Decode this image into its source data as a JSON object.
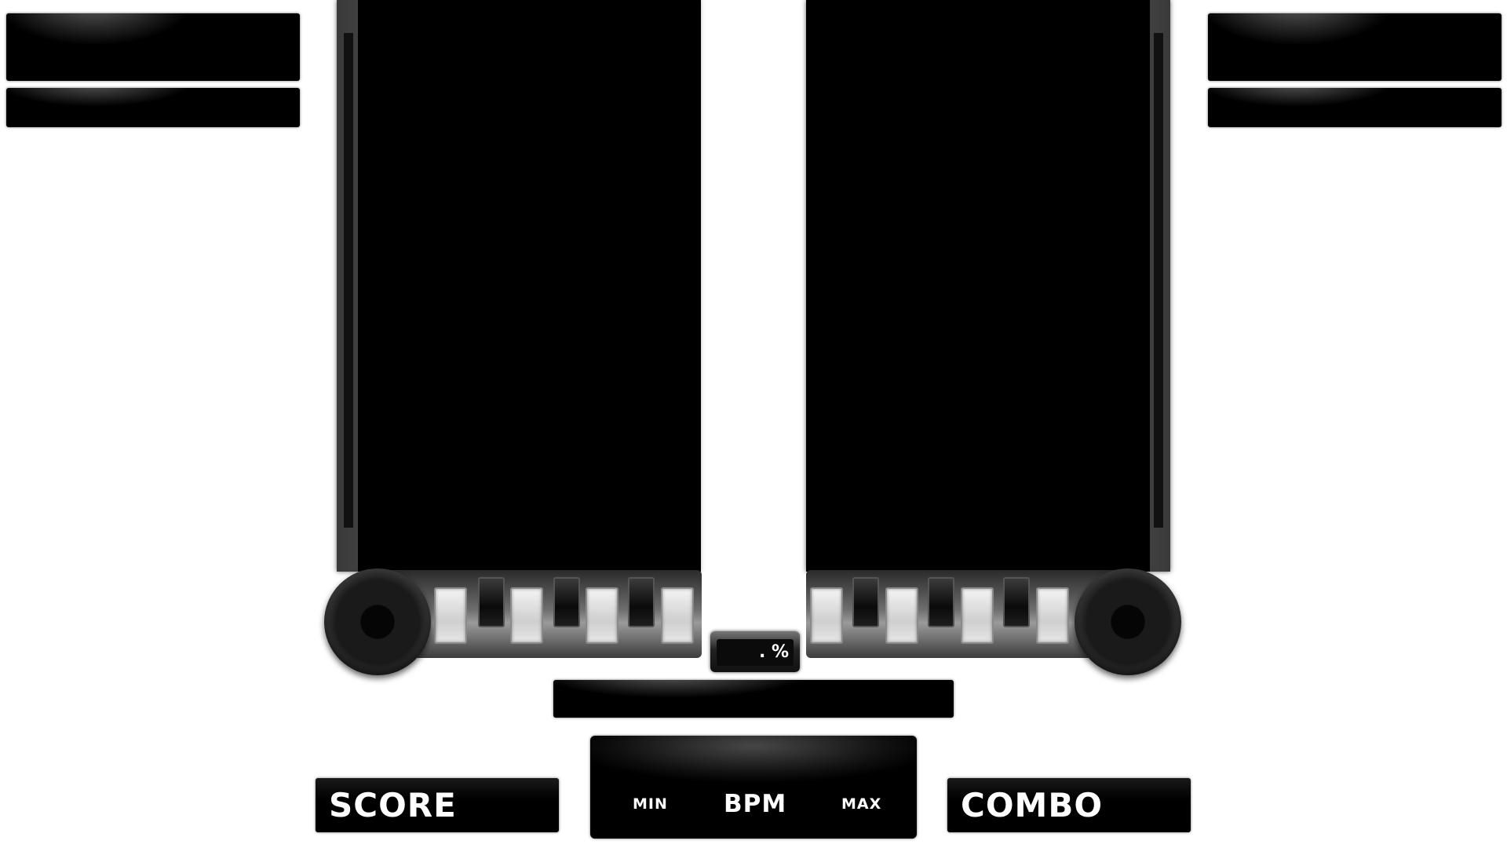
{
  "hud": {
    "score_label": "SCORE",
    "combo_label": "COMBO",
    "bpm_label": "BPM",
    "bpm_min_label": "MIN",
    "bpm_max_label": "MAX",
    "gauge_readout": ". %"
  },
  "colors": {
    "background": "#ffffff",
    "panel": "#000000",
    "frame": "#5a5a5a",
    "key_white": "#e6e6e6",
    "key_black": "#111111"
  }
}
